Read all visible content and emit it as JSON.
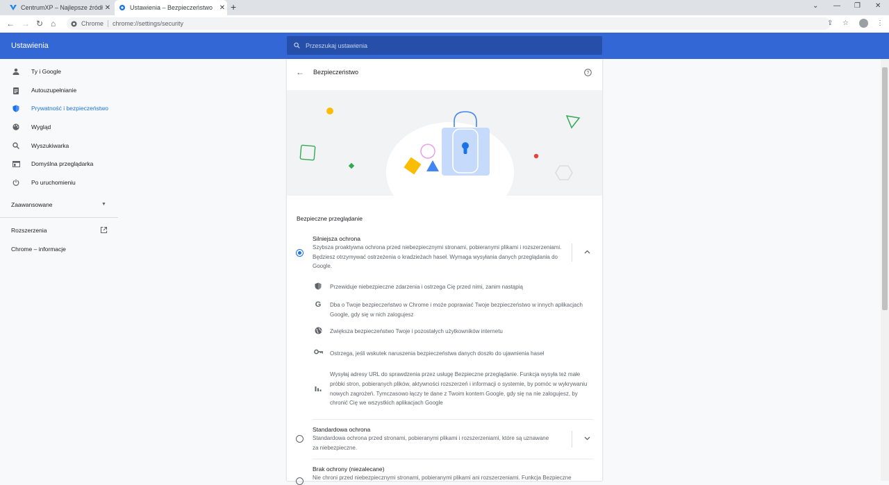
{
  "tabs": [
    {
      "title": "CentrumXP – Najlepsze źródło z",
      "icon": "centrumxp-icon"
    },
    {
      "title": "Ustawienia – Bezpieczeństwo",
      "icon": "settings-gear-icon"
    }
  ],
  "toolbar": {
    "site_name": "Chrome",
    "url": "chrome://settings/security"
  },
  "header": {
    "title": "Ustawienia",
    "search_placeholder": "Przeszukaj ustawienia"
  },
  "sidebar": {
    "items": [
      {
        "label": "Ty i Google",
        "icon": "person-icon"
      },
      {
        "label": "Autouzupełnianie",
        "icon": "clipboard-icon"
      },
      {
        "label": "Prywatność i bezpieczeństwo",
        "icon": "shield-icon",
        "active": true
      },
      {
        "label": "Wygląd",
        "icon": "palette-icon"
      },
      {
        "label": "Wyszukiwarka",
        "icon": "search-icon"
      },
      {
        "label": "Domyślna przeglądarka",
        "icon": "browser-icon"
      },
      {
        "label": "Po uruchomieniu",
        "icon": "power-icon"
      }
    ],
    "advanced": "Zaawansowane",
    "extensions": "Rozszerzenia",
    "about": "Chrome – informacje"
  },
  "page": {
    "title": "Bezpieczeństwo",
    "section_title": "Bezpieczne przeglądanie",
    "options": [
      {
        "title": "Silniejsza ochrona",
        "description": "Szybsza proaktywna ochrona przed niebezpiecznymi stronami, pobieranymi plikami i rozszerzeniami. Będziesz otrzymywać ostrzeżenia o kradzieżach haseł. Wymaga wysyłania danych przeglądania do Google.",
        "selected": true,
        "bullets": [
          {
            "icon": "shield-icon",
            "text": "Przewiduje niebezpieczne zdarzenia i ostrzega Cię przed nimi, zanim nastąpią"
          },
          {
            "icon": "google-icon",
            "text": "Dba o Twoje bezpieczeństwo w Chrome i może poprawiać Twoje bezpieczeństwo w innych aplikacjach Google, gdy się w nich zalogujesz"
          },
          {
            "icon": "globe-icon",
            "text": "Zwiększa bezpieczeństwo Twoje i pozostałych użytkowników internetu"
          },
          {
            "icon": "key-icon",
            "text": "Ostrzega, jeśli wskutek naruszenia bezpieczeństwa danych doszło do ujawnienia haseł"
          },
          {
            "icon": "bar-chart-icon",
            "text": "Wysyłaj adresy URL do sprawdzenia przez usługę Bezpieczne przeglądanie. Funkcja wysyła też małe próbki stron, pobieranych plików, aktywności rozszerzeń i informacji o systemie, by pomóc w wykrywaniu nowych zagrożeń. Tymczasowo łączy te dane z Twoim kontem Google, gdy się na nie zalogujesz, by chronić Cię we wszystkich aplikacjach Google"
          }
        ]
      },
      {
        "title": "Standardowa ochrona",
        "description": "Standardowa ochrona przed stronami, pobieranymi plikami i rozszerzeniami, które są uznawane za niebezpieczne.",
        "selected": false
      },
      {
        "title": "Brak ochrony (niezalecane)",
        "description": "Nie chroni przed niebezpiecznymi stronami, pobieranymi plikami ani rozszerzeniami. Funkcja Bezpieczne",
        "selected": false
      }
    ]
  },
  "colors": {
    "header": "#3367d6",
    "accent": "#1a73e8",
    "tabstrip": "#dee1e6"
  }
}
